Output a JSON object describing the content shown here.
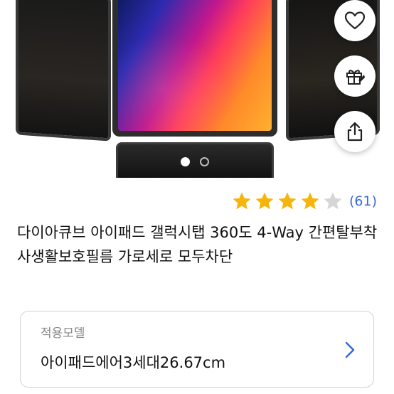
{
  "gallery": {
    "slide_count": 2,
    "active_slide": 1
  },
  "actions": {
    "wishlist_icon": "heart-outline-icon",
    "gift_icon": "gift-icon",
    "share_icon": "share-icon"
  },
  "rating": {
    "stars": 4,
    "max_stars": 5,
    "review_count": "(61)",
    "star_color": "#f5b50a",
    "empty_star_color": "#d6d6d6",
    "count_color": "#3a6ad8"
  },
  "product": {
    "title": "다이아큐브 아이패드 갤럭시탭 360도 4-Way 간편탈부착 사생활보호필름 가로세로 모두차단"
  },
  "option": {
    "label": "적용모델",
    "value": "아이패드에어3세대26.67cm"
  }
}
